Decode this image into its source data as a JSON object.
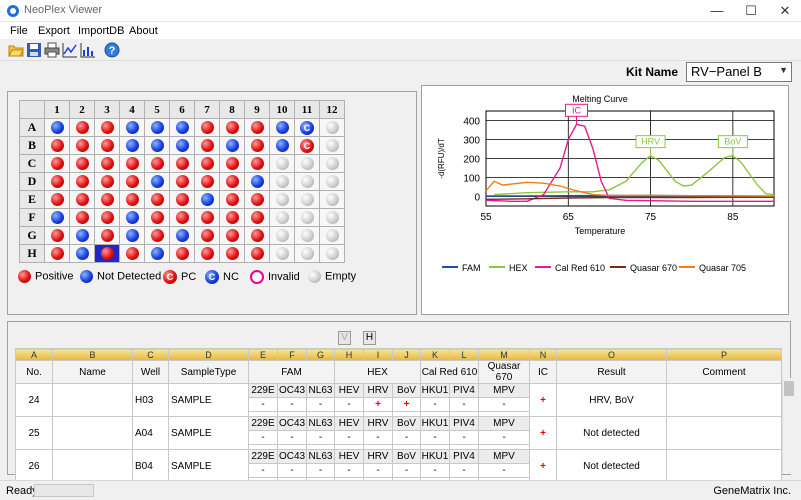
{
  "window": {
    "title": "NeoPlex Viewer",
    "minimize": "—",
    "maximize": "☐",
    "close": "✕"
  },
  "menu": [
    "File",
    "Export",
    "ImportDB",
    "About"
  ],
  "kit": {
    "label": "Kit Name",
    "value": "RV−Panel B"
  },
  "plate": {
    "columns": [
      "1",
      "2",
      "3",
      "4",
      "5",
      "6",
      "7",
      "8",
      "9",
      "10",
      "11",
      "12"
    ],
    "rows": [
      {
        "label": "A",
        "wells": [
          "neg",
          "pos",
          "pos",
          "neg",
          "neg",
          "neg",
          "pos",
          "pos",
          "pos",
          "neg",
          "NC",
          "empty"
        ]
      },
      {
        "label": "B",
        "wells": [
          "pos",
          "pos",
          "pos",
          "neg",
          "neg",
          "neg",
          "pos",
          "neg",
          "pos",
          "neg",
          "PC",
          "empty"
        ]
      },
      {
        "label": "C",
        "wells": [
          "pos",
          "pos",
          "pos",
          "pos",
          "pos",
          "pos",
          "pos",
          "pos",
          "pos",
          "empty",
          "empty",
          "empty"
        ]
      },
      {
        "label": "D",
        "wells": [
          "pos",
          "pos",
          "pos",
          "pos",
          "neg",
          "pos",
          "pos",
          "pos",
          "neg",
          "empty",
          "empty",
          "empty"
        ]
      },
      {
        "label": "E",
        "wells": [
          "pos",
          "pos",
          "pos",
          "pos",
          "pos",
          "pos",
          "neg",
          "pos",
          "pos",
          "empty",
          "empty",
          "empty"
        ]
      },
      {
        "label": "F",
        "wells": [
          "neg",
          "pos",
          "pos",
          "neg",
          "pos",
          "pos",
          "pos",
          "pos",
          "pos",
          "empty",
          "empty",
          "empty"
        ]
      },
      {
        "label": "G",
        "wells": [
          "pos",
          "neg",
          "pos",
          "neg",
          "pos",
          "neg",
          "pos",
          "pos",
          "pos",
          "empty",
          "empty",
          "empty"
        ]
      },
      {
        "label": "H",
        "wells": [
          "pos",
          "neg",
          "pos",
          "pos",
          "neg",
          "pos",
          "pos",
          "pos",
          "pos",
          "empty",
          "empty",
          "empty"
        ]
      }
    ],
    "selected_well": "H3",
    "pc_label": "C",
    "nc_label": "C",
    "legend": {
      "positive": "Positive",
      "not_detected": "Not Detected",
      "pc": "PC",
      "nc": "NC",
      "invalid": "Invalid",
      "empty": "Empty"
    }
  },
  "chart_data": {
    "type": "line",
    "title": "Melting Curve",
    "xlabel": "Temperature",
    "ylabel": "-d(RFU)/dT",
    "xlim": [
      55,
      90
    ],
    "ylim": [
      -50,
      450
    ],
    "xticks": [
      55,
      65,
      75,
      85
    ],
    "yticks": [
      0,
      100,
      200,
      300,
      400
    ],
    "grid": true,
    "legend_position": "bottom",
    "series": [
      {
        "name": "FAM",
        "color": "#1f4fa8",
        "points": [
          [
            55,
            2
          ],
          [
            60,
            3
          ],
          [
            65,
            4
          ],
          [
            70,
            5
          ],
          [
            75,
            5
          ],
          [
            80,
            4
          ],
          [
            85,
            3
          ],
          [
            90,
            2
          ]
        ]
      },
      {
        "name": "HEX",
        "color": "#8dc63f",
        "points": [
          [
            56,
            10
          ],
          [
            60,
            20
          ],
          [
            65,
            25
          ],
          [
            68,
            25
          ],
          [
            70,
            35
          ],
          [
            72,
            80
          ],
          [
            74,
            180
          ],
          [
            75,
            215
          ],
          [
            76,
            190
          ],
          [
            78,
            80
          ],
          [
            79,
            55
          ],
          [
            80,
            60
          ],
          [
            82,
            130
          ],
          [
            84,
            205
          ],
          [
            85,
            215
          ],
          [
            86,
            180
          ],
          [
            88,
            60
          ],
          [
            89,
            15
          ],
          [
            90,
            10
          ]
        ]
      },
      {
        "name": "Cal Red 610",
        "color": "#e6198c",
        "points": [
          [
            55,
            -20
          ],
          [
            58,
            -25
          ],
          [
            60,
            -25
          ],
          [
            62,
            10
          ],
          [
            64,
            150
          ],
          [
            65,
            300
          ],
          [
            66,
            380
          ],
          [
            67,
            370
          ],
          [
            68,
            250
          ],
          [
            69,
            80
          ],
          [
            70,
            -10
          ],
          [
            72,
            -20
          ],
          [
            80,
            -25
          ],
          [
            90,
            -25
          ]
        ]
      },
      {
        "name": "Quasar 670",
        "color": "#7a2a1a",
        "points": [
          [
            55,
            -15
          ],
          [
            60,
            -12
          ],
          [
            65,
            -8
          ],
          [
            70,
            -6
          ],
          [
            75,
            -5
          ],
          [
            80,
            -5
          ],
          [
            85,
            -4
          ],
          [
            90,
            -4
          ]
        ]
      },
      {
        "name": "Quasar 705",
        "color": "#f07d1e",
        "points": [
          [
            55,
            30
          ],
          [
            56,
            80
          ],
          [
            57,
            60
          ],
          [
            60,
            75
          ],
          [
            62,
            70
          ],
          [
            64,
            55
          ],
          [
            66,
            30
          ],
          [
            68,
            10
          ],
          [
            70,
            5
          ],
          [
            75,
            5
          ],
          [
            80,
            4
          ],
          [
            85,
            3
          ],
          [
            90,
            2
          ]
        ]
      }
    ],
    "annotations": [
      {
        "text": "IC",
        "x": 66,
        "y": 380,
        "color": "#e6198c"
      },
      {
        "text": "HRV",
        "x": 75,
        "y": 215,
        "color": "#8dc63f"
      },
      {
        "text": "BoV",
        "x": 85,
        "y": 215,
        "color": "#8dc63f"
      }
    ]
  },
  "filters": {
    "v": "V",
    "h": "H"
  },
  "table": {
    "col_letters": [
      "A",
      "B",
      "C",
      "D",
      "E",
      "F",
      "G",
      "H",
      "I",
      "J",
      "K",
      "L",
      "M",
      "N",
      "O",
      "P"
    ],
    "headers": {
      "no": "No.",
      "name": "Name",
      "well": "Well",
      "sampletype": "SampleType",
      "fam": "FAM",
      "hex": "HEX",
      "calred": "Cal Red 610",
      "quasar": "Quasar 670",
      "ic": "IC",
      "result": "Result",
      "comment": "Comment"
    },
    "targets": [
      "229E",
      "OC43",
      "NL63",
      "HEV",
      "HRV",
      "BoV",
      "HKU1",
      "PIV4",
      "MPV"
    ],
    "rows": [
      {
        "no": "24",
        "name": "",
        "well": "H03",
        "type": "SAMPLE",
        "vals": [
          "-",
          "-",
          "-",
          "-",
          "+",
          "+",
          "-",
          "-",
          "-"
        ],
        "ic": "+",
        "result": "HRV, BoV",
        "comment": ""
      },
      {
        "no": "25",
        "name": "",
        "well": "A04",
        "type": "SAMPLE",
        "vals": [
          "-",
          "-",
          "-",
          "-",
          "-",
          "-",
          "-",
          "-",
          "-"
        ],
        "ic": "+",
        "result": "Not detected",
        "comment": ""
      },
      {
        "no": "26",
        "name": "",
        "well": "B04",
        "type": "SAMPLE",
        "vals": [
          "-",
          "-",
          "-",
          "-",
          "-",
          "-",
          "-",
          "-",
          "-"
        ],
        "ic": "+",
        "result": "Not detected",
        "comment": ""
      }
    ]
  },
  "status": {
    "text": "Ready",
    "company": "GeneMatrix Inc."
  }
}
